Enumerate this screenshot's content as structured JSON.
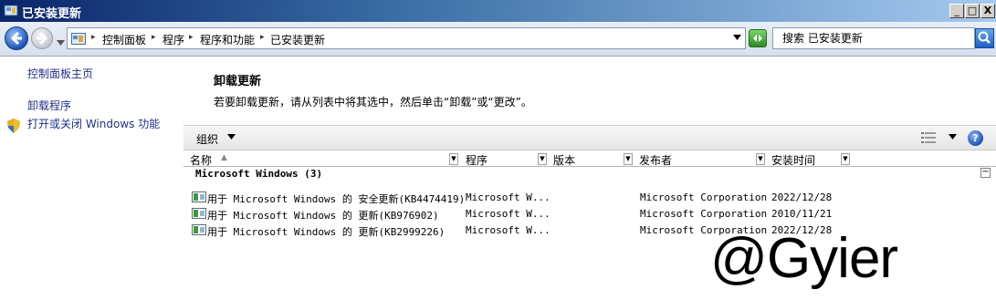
{
  "window": {
    "title": "已安装更新",
    "minimize_label": "_",
    "maximize_label": "□",
    "close_label": "X"
  },
  "address_bar": {
    "breadcrumbs": [
      "控制面板",
      "程序",
      "程序和功能",
      "已安装更新"
    ]
  },
  "search": {
    "placeholder": "搜索 已安装更新"
  },
  "sidebar": {
    "links": [
      "控制面板主页",
      "卸载程序",
      "打开或关闭 Windows 功能"
    ]
  },
  "main": {
    "title": "卸载更新",
    "description": "若要卸载更新，请从列表中将其选中，然后单击“卸载”或“更改”。"
  },
  "toolbar": {
    "organize_label": "组织",
    "help_label": "?"
  },
  "table": {
    "columns": [
      "名称",
      "程序",
      "版本",
      "发布者",
      "安装时间"
    ],
    "group_label": "Microsoft Windows (3)",
    "collapse_label": "−",
    "rows": [
      {
        "name": "用于 Microsoft Windows 的 安全更新(KB4474419)",
        "program": "Microsoft W...",
        "version": "",
        "publisher": "Microsoft Corporation",
        "date": "2022/12/28"
      },
      {
        "name": "用于 Microsoft Windows 的 更新(KB976902)",
        "program": "Microsoft W...",
        "version": "",
        "publisher": "Microsoft Corporation",
        "date": "2010/11/21"
      },
      {
        "name": "用于 Microsoft Windows 的 更新(KB2999226)",
        "program": "Microsoft W...",
        "version": "",
        "publisher": "Microsoft Corporation",
        "date": "2022/12/28"
      }
    ]
  },
  "watermark": "@Gyier",
  "colors": {
    "titlebar_start": "#0a246a",
    "link": "#1e3287",
    "toolbar_bg": "#e6e6e6"
  },
  "icons": [
    "control-panel-icon",
    "back-arrow-icon",
    "forward-arrow-icon",
    "folder-icon",
    "refresh-icon",
    "search-icon",
    "shield-icon",
    "views-icon",
    "help-icon",
    "update-icon"
  ]
}
